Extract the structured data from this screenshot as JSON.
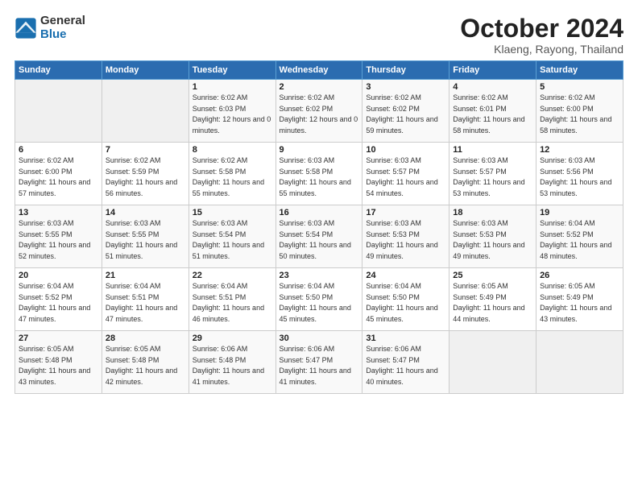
{
  "logo": {
    "general": "General",
    "blue": "Blue"
  },
  "title": "October 2024",
  "subtitle": "Klaeng, Rayong, Thailand",
  "days_header": [
    "Sunday",
    "Monday",
    "Tuesday",
    "Wednesday",
    "Thursday",
    "Friday",
    "Saturday"
  ],
  "weeks": [
    [
      {
        "day": "",
        "empty": true
      },
      {
        "day": "",
        "empty": true
      },
      {
        "day": "1",
        "sunrise": "6:02 AM",
        "sunset": "6:03 PM",
        "daylight": "12 hours and 0 minutes."
      },
      {
        "day": "2",
        "sunrise": "6:02 AM",
        "sunset": "6:02 PM",
        "daylight": "12 hours and 0 minutes."
      },
      {
        "day": "3",
        "sunrise": "6:02 AM",
        "sunset": "6:02 PM",
        "daylight": "11 hours and 59 minutes."
      },
      {
        "day": "4",
        "sunrise": "6:02 AM",
        "sunset": "6:01 PM",
        "daylight": "11 hours and 58 minutes."
      },
      {
        "day": "5",
        "sunrise": "6:02 AM",
        "sunset": "6:00 PM",
        "daylight": "11 hours and 58 minutes."
      }
    ],
    [
      {
        "day": "6",
        "sunrise": "6:02 AM",
        "sunset": "6:00 PM",
        "daylight": "11 hours and 57 minutes."
      },
      {
        "day": "7",
        "sunrise": "6:02 AM",
        "sunset": "5:59 PM",
        "daylight": "11 hours and 56 minutes."
      },
      {
        "day": "8",
        "sunrise": "6:02 AM",
        "sunset": "5:58 PM",
        "daylight": "11 hours and 55 minutes."
      },
      {
        "day": "9",
        "sunrise": "6:03 AM",
        "sunset": "5:58 PM",
        "daylight": "11 hours and 55 minutes."
      },
      {
        "day": "10",
        "sunrise": "6:03 AM",
        "sunset": "5:57 PM",
        "daylight": "11 hours and 54 minutes."
      },
      {
        "day": "11",
        "sunrise": "6:03 AM",
        "sunset": "5:57 PM",
        "daylight": "11 hours and 53 minutes."
      },
      {
        "day": "12",
        "sunrise": "6:03 AM",
        "sunset": "5:56 PM",
        "daylight": "11 hours and 53 minutes."
      }
    ],
    [
      {
        "day": "13",
        "sunrise": "6:03 AM",
        "sunset": "5:55 PM",
        "daylight": "11 hours and 52 minutes."
      },
      {
        "day": "14",
        "sunrise": "6:03 AM",
        "sunset": "5:55 PM",
        "daylight": "11 hours and 51 minutes."
      },
      {
        "day": "15",
        "sunrise": "6:03 AM",
        "sunset": "5:54 PM",
        "daylight": "11 hours and 51 minutes."
      },
      {
        "day": "16",
        "sunrise": "6:03 AM",
        "sunset": "5:54 PM",
        "daylight": "11 hours and 50 minutes."
      },
      {
        "day": "17",
        "sunrise": "6:03 AM",
        "sunset": "5:53 PM",
        "daylight": "11 hours and 49 minutes."
      },
      {
        "day": "18",
        "sunrise": "6:03 AM",
        "sunset": "5:53 PM",
        "daylight": "11 hours and 49 minutes."
      },
      {
        "day": "19",
        "sunrise": "6:04 AM",
        "sunset": "5:52 PM",
        "daylight": "11 hours and 48 minutes."
      }
    ],
    [
      {
        "day": "20",
        "sunrise": "6:04 AM",
        "sunset": "5:52 PM",
        "daylight": "11 hours and 47 minutes."
      },
      {
        "day": "21",
        "sunrise": "6:04 AM",
        "sunset": "5:51 PM",
        "daylight": "11 hours and 47 minutes."
      },
      {
        "day": "22",
        "sunrise": "6:04 AM",
        "sunset": "5:51 PM",
        "daylight": "11 hours and 46 minutes."
      },
      {
        "day": "23",
        "sunrise": "6:04 AM",
        "sunset": "5:50 PM",
        "daylight": "11 hours and 45 minutes."
      },
      {
        "day": "24",
        "sunrise": "6:04 AM",
        "sunset": "5:50 PM",
        "daylight": "11 hours and 45 minutes."
      },
      {
        "day": "25",
        "sunrise": "6:05 AM",
        "sunset": "5:49 PM",
        "daylight": "11 hours and 44 minutes."
      },
      {
        "day": "26",
        "sunrise": "6:05 AM",
        "sunset": "5:49 PM",
        "daylight": "11 hours and 43 minutes."
      }
    ],
    [
      {
        "day": "27",
        "sunrise": "6:05 AM",
        "sunset": "5:48 PM",
        "daylight": "11 hours and 43 minutes."
      },
      {
        "day": "28",
        "sunrise": "6:05 AM",
        "sunset": "5:48 PM",
        "daylight": "11 hours and 42 minutes."
      },
      {
        "day": "29",
        "sunrise": "6:06 AM",
        "sunset": "5:48 PM",
        "daylight": "11 hours and 41 minutes."
      },
      {
        "day": "30",
        "sunrise": "6:06 AM",
        "sunset": "5:47 PM",
        "daylight": "11 hours and 41 minutes."
      },
      {
        "day": "31",
        "sunrise": "6:06 AM",
        "sunset": "5:47 PM",
        "daylight": "11 hours and 40 minutes."
      },
      {
        "day": "",
        "empty": true
      },
      {
        "day": "",
        "empty": true
      }
    ]
  ],
  "labels": {
    "sunrise": "Sunrise: ",
    "sunset": "Sunset: ",
    "daylight": "Daylight: "
  }
}
